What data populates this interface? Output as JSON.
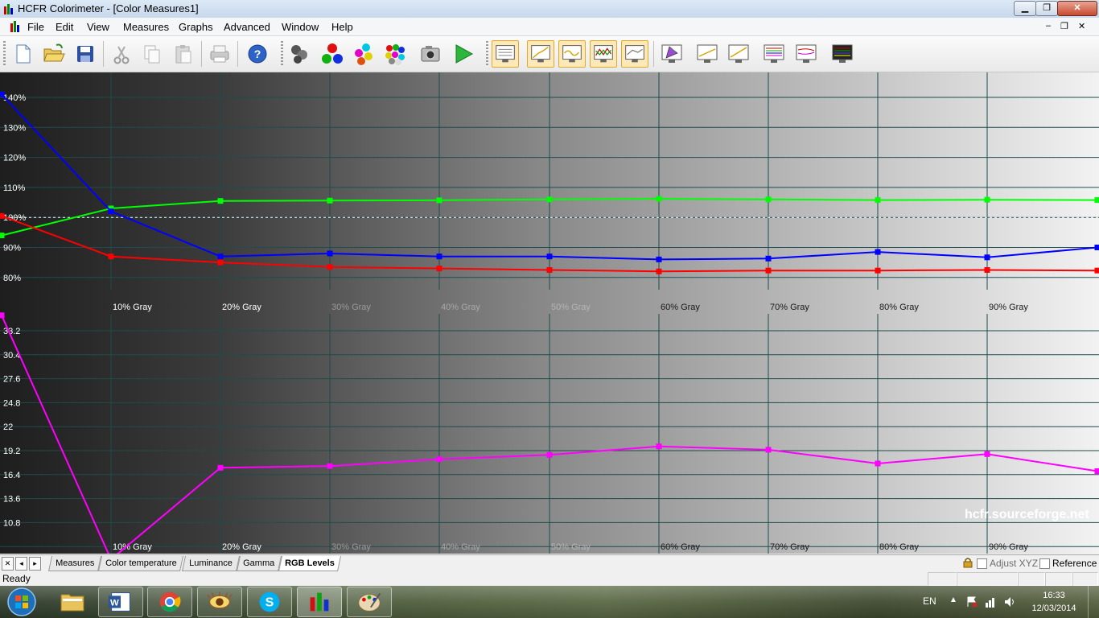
{
  "window": {
    "title": "HCFR Colorimeter - [Color Measures1]",
    "min_label": "▁",
    "max_label": "❐",
    "close_label": "✕"
  },
  "menu": {
    "items": [
      "File",
      "Edit",
      "View",
      "Measures",
      "Graphs",
      "Advanced",
      "Window",
      "Help"
    ],
    "mdi_min": "–",
    "mdi_restore": "❐",
    "mdi_close": "✕"
  },
  "toolbar": {
    "icons": [
      "new-document-icon",
      "open-folder-icon",
      "save-icon",
      "cut-icon",
      "copy-icon",
      "paste-icon",
      "print-icon",
      "help-icon",
      "sensor-icon",
      "rgb-balls-icon",
      "color-balls-icon",
      "multi-color-balls-icon",
      "camera-icon",
      "play-icon",
      "view-measures-icon",
      "view-color-temp-icon",
      "view-luminance-icon",
      "view-gamma-icon",
      "view-rgb-levels-icon",
      "cie-diagram-icon",
      "near-black-icon",
      "near-white-icon",
      "saturation-shift-icon",
      "saturation-luminance-icon",
      "color-checker-icon"
    ]
  },
  "chart_data": [
    {
      "type": "line",
      "title": "",
      "categories": [
        "",
        "10% Gray",
        "20% Gray",
        "30% Gray",
        "40% Gray",
        "50% Gray",
        "60% Gray",
        "70% Gray",
        "80% Gray",
        "90% Gray",
        ""
      ],
      "y_ticks": [
        "80%",
        "90%",
        "100%",
        "110%",
        "120%",
        "130%",
        "140%"
      ],
      "ylim": [
        75,
        148
      ],
      "reference_line": 100,
      "series": [
        {
          "color": "#00ff00",
          "values": [
            94,
            103,
            105.5,
            105.6,
            105.7,
            106,
            106.2,
            106,
            105.8,
            105.9,
            105.8
          ]
        },
        {
          "color": "#0000ff",
          "values": [
            141,
            102,
            87,
            88,
            87,
            87,
            86,
            86.3,
            88.5,
            86.7,
            90
          ]
        },
        {
          "color": "#ff0000",
          "values": [
            100.5,
            87,
            85,
            83.5,
            83,
            82.5,
            82,
            82.3,
            82.3,
            82.5,
            82.3
          ]
        }
      ],
      "grid": true
    },
    {
      "type": "line",
      "title": "",
      "categories": [
        "",
        "10% Gray",
        "20% Gray",
        "30% Gray",
        "40% Gray",
        "50% Gray",
        "60% Gray",
        "70% Gray",
        "80% Gray",
        "90% Gray",
        ""
      ],
      "y_ticks": [
        "10.8",
        "13.6",
        "16.4",
        "19.2",
        "22",
        "24.8",
        "27.6",
        "30.4",
        "33.2"
      ],
      "ylim": [
        8.2,
        35.8
      ],
      "series": [
        {
          "color": "#ff00ff",
          "values": [
            35,
            6.5,
            17.2,
            17.4,
            18.2,
            18.7,
            19.7,
            19.3,
            17.7,
            18.8,
            16.8
          ]
        }
      ],
      "grid": true
    }
  ],
  "watermark": "hcfr.sourceforge.net",
  "tabs": {
    "items": [
      "Measures",
      "Color temperature",
      "Luminance",
      "Gamma",
      "RGB Levels"
    ],
    "active": "RGB Levels",
    "adjust_label": "Adjust XYZ",
    "reference_label": "Reference"
  },
  "status": {
    "text": "Ready"
  },
  "taskbar": {
    "apps": [
      "explorer-icon",
      "word-icon",
      "chrome-icon",
      "eye-app-icon",
      "skype-icon",
      "hcfr-icon",
      "paint-icon"
    ],
    "language": "EN",
    "time": "16:33",
    "date": "12/03/2014"
  }
}
